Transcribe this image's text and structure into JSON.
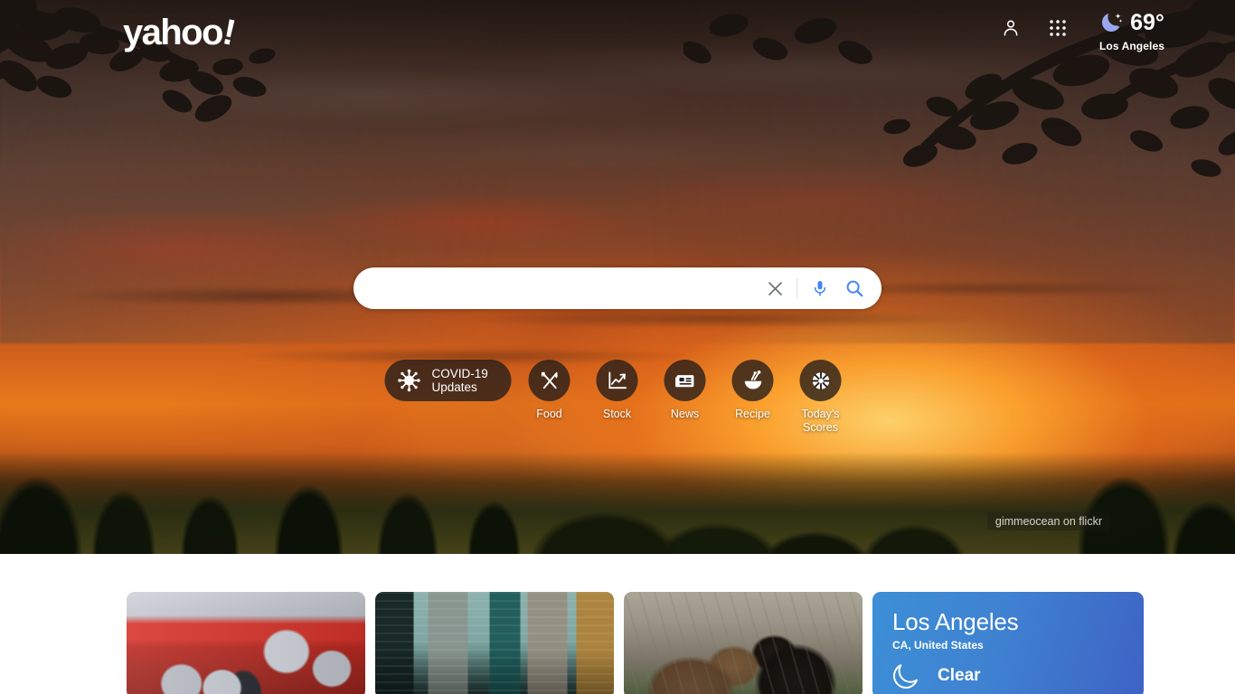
{
  "brand": {
    "logo_text": "yahoo",
    "logo_bang": "!"
  },
  "header": {
    "profile_icon": "person-icon",
    "apps_icon": "apps-grid-icon",
    "weather": {
      "icon": "crescent-moon-icon",
      "temperature": "69°",
      "city": "Los Angeles"
    }
  },
  "search": {
    "value": "",
    "placeholder": "",
    "clear_icon": "close-icon",
    "mic_icon": "microphone-icon",
    "search_icon": "search-icon"
  },
  "shortcuts": {
    "pill": {
      "label": "COVID-19 Updates",
      "icon": "virus-icon"
    },
    "items": [
      {
        "label": "Food",
        "icon": "fork-knife-icon"
      },
      {
        "label": "Stock",
        "icon": "line-chart-icon"
      },
      {
        "label": "News",
        "icon": "newspaper-icon"
      },
      {
        "label": "Recipe",
        "icon": "mortar-pestle-icon"
      },
      {
        "label": "Today's Scores",
        "icon": "basketball-icon"
      }
    ]
  },
  "hero": {
    "photo_credit": "gimmeocean on flickr"
  },
  "content": {
    "news_cards": [
      {
        "name": "football-team-photo"
      },
      {
        "name": "city-skyline-photo"
      },
      {
        "name": "two-bears-photo"
      }
    ],
    "weather_card": {
      "city": "Los Angeles",
      "region": "CA, United States",
      "condition": "Clear",
      "icon": "crescent-moon-outline-icon"
    }
  },
  "colors": {
    "accent_blue": "#4285f4",
    "pill_dark": "rgba(35,28,25,0.78)",
    "weather_card_from": "#3c8fd6",
    "weather_card_to": "#3d63c4"
  }
}
